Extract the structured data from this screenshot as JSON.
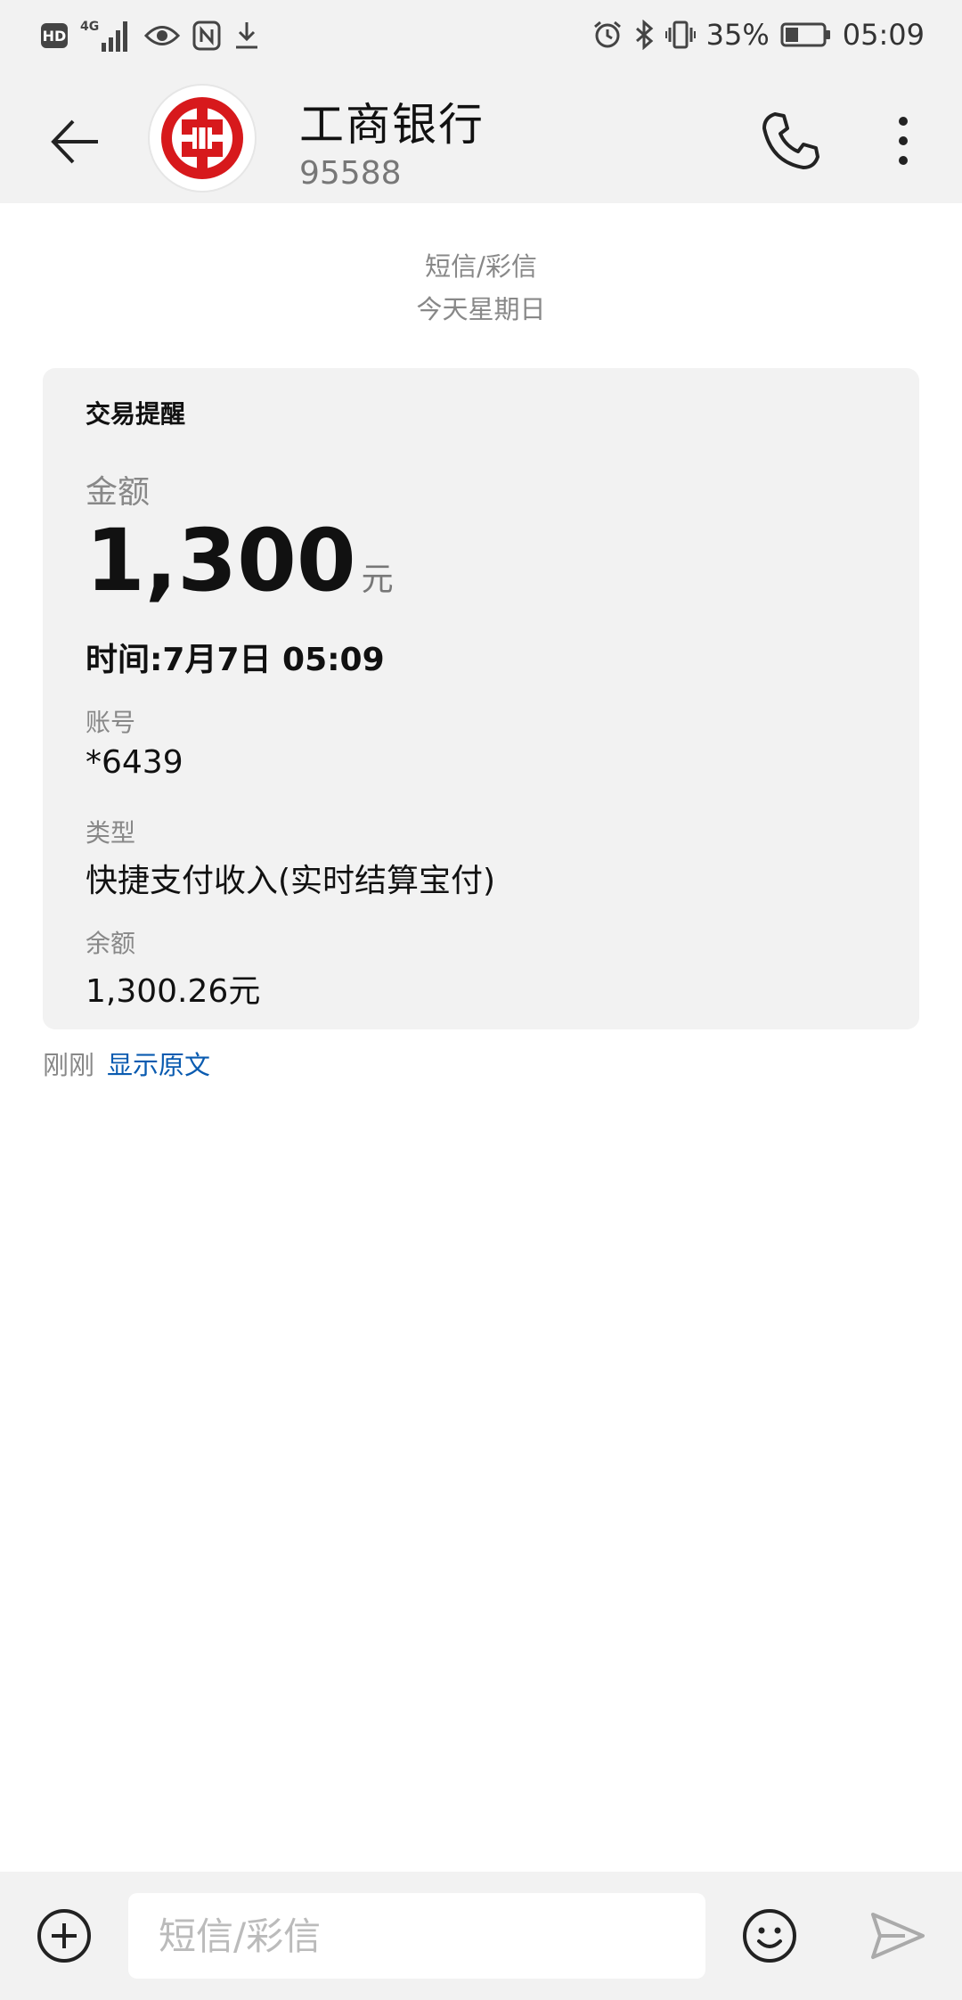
{
  "status_bar": {
    "left_icons": [
      "hd-icon",
      "signal-4g-icon",
      "eye-icon",
      "nfc-icon",
      "download-icon"
    ],
    "hd_label": "HD",
    "network_label": "4G",
    "battery_percent": "35%",
    "battery_level": 0.35,
    "time": "05:09"
  },
  "header": {
    "contact_name": "工商银行",
    "contact_number": "95588",
    "colors": {
      "bank_red": "#d7191c"
    }
  },
  "meta": {
    "channel": "短信/彩信",
    "date": "今天星期日"
  },
  "message_card": {
    "title": "交易提醒",
    "amount_label": "金额",
    "amount_value": "1,300",
    "amount_unit": "元",
    "time_line": "时间:7月7日 05:09",
    "account_label": "账号",
    "account_value": "*6439",
    "type_label": "类型",
    "type_value": "快捷支付收入(实时结算宝付)",
    "balance_label": "余额",
    "balance_value": "1,300.26元"
  },
  "message_footer": {
    "time": "刚刚",
    "show_original": "显示原文",
    "link_color": "#0a5bb0"
  },
  "composer": {
    "placeholder": "短信/彩信"
  }
}
